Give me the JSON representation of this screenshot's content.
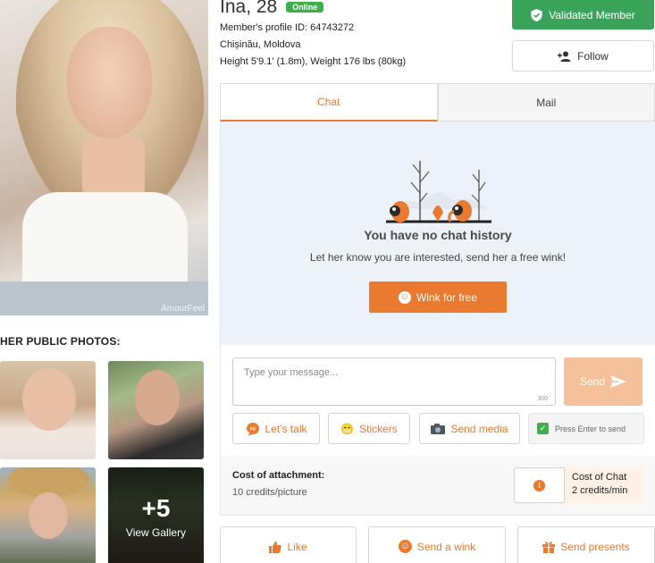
{
  "profile": {
    "name_age": "Ina, 28",
    "status_badge": "Online",
    "profile_id": "Member's profile ID: 64743272",
    "location": "Chișinău, Moldova",
    "body_info": "Height 5'9.1' (1.8m), Weight 176 lbs (80kg)",
    "photo_watermark": "AmourFeel"
  },
  "badges": {
    "validated_label": "Validated Member",
    "follow_label": "Follow"
  },
  "photos": {
    "section_title": "HER PUBLIC PHOTOS:",
    "more_count": "+5",
    "view_gallery": "View Gallery"
  },
  "tabs": [
    {
      "label": "Chat",
      "active": true
    },
    {
      "label": "Mail",
      "active": false
    }
  ],
  "chat": {
    "empty_title": "You have no chat history",
    "empty_subtitle": "Let her know you are interested, send her a free wink!",
    "wink_button": "Wink for free"
  },
  "composer": {
    "placeholder": "Type your message...",
    "char_limit": "300",
    "send_label": "Send",
    "tools": {
      "talk": "Let's talk",
      "stickers": "Stickers",
      "media": "Send media"
    },
    "press_enter": "Press Enter to send",
    "press_enter_checked": true
  },
  "cost": {
    "attachment_title": "Cost of attachment:",
    "attachment_value": "10 credits/picture",
    "chat_title": "Cost of Chat",
    "chat_value": "2 credits/min"
  },
  "actions": {
    "like": "Like",
    "send_wink": "Send a wink",
    "send_presents": "Send presents"
  },
  "colors": {
    "accent": "#ea7a2f",
    "online_green": "#3eb04b",
    "validated_green": "#3aa35a",
    "send_disabled": "#f5c19a",
    "chat_bg": "#edf2f8"
  },
  "icons": [
    "shield-check-icon",
    "person-add-icon",
    "smile-icon",
    "send-arrow-icon",
    "chat-hi-icon",
    "sticker-icon",
    "camera-icon",
    "checkbox-icon",
    "info-icon",
    "thumbs-up-icon",
    "gift-icon"
  ]
}
